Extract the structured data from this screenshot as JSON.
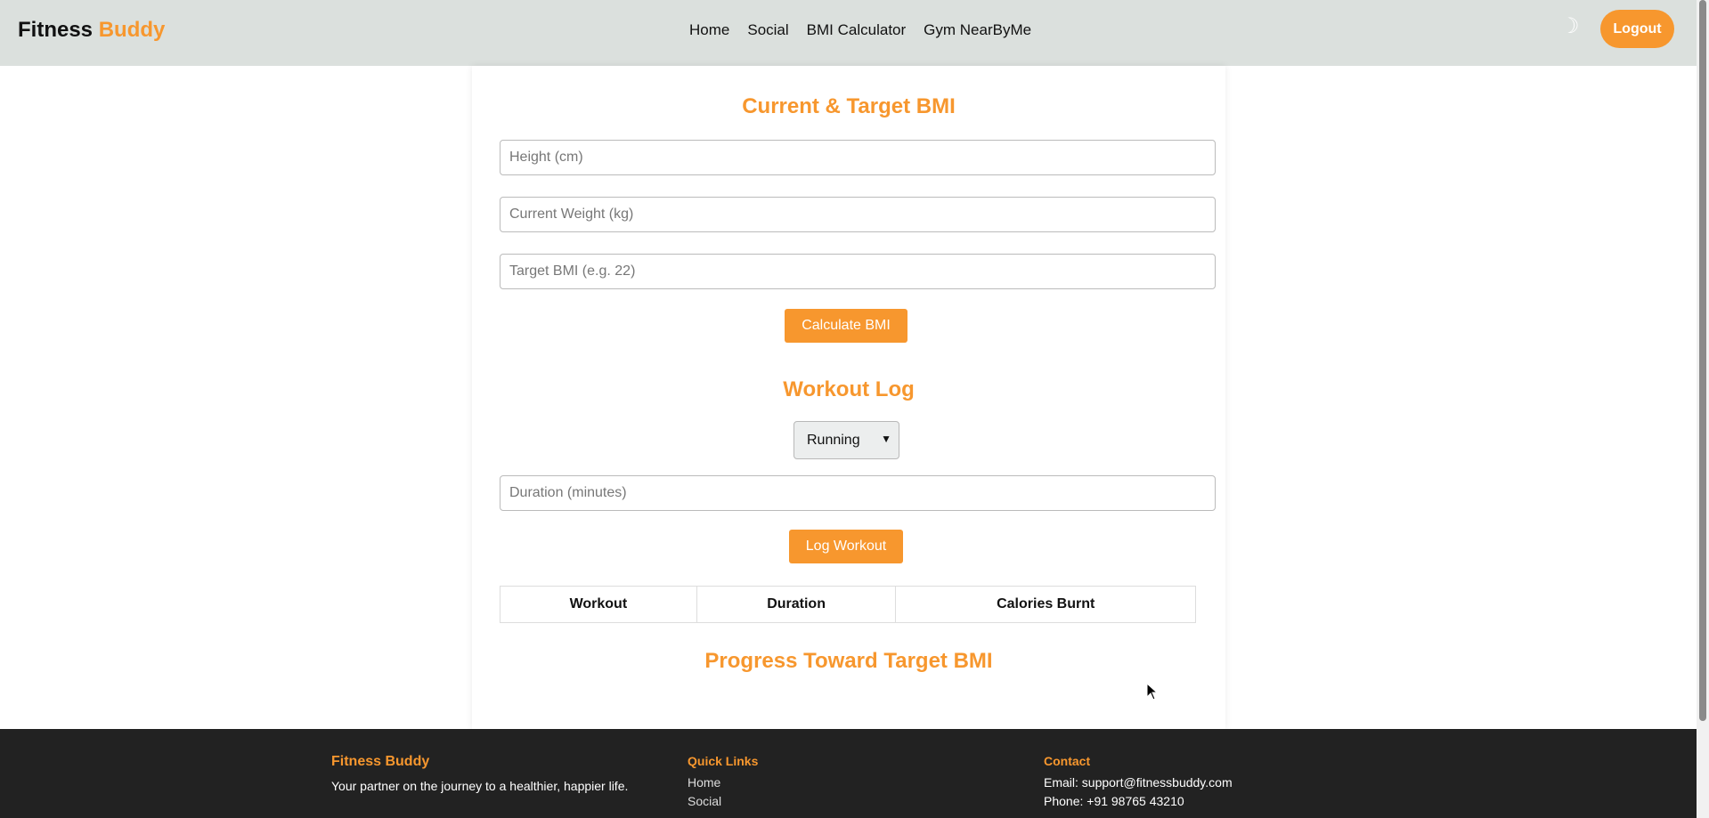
{
  "navbar": {
    "brand_main": "Fitness",
    "brand_accent": "Buddy",
    "links": [
      "Home",
      "Social",
      "BMI Calculator",
      "Gym NearByMe"
    ],
    "theme_icon": "moon-icon",
    "logout_label": "Logout"
  },
  "bmi": {
    "title": "Current & Target BMI",
    "height_placeholder": "Height (cm)",
    "weight_placeholder": "Current Weight (kg)",
    "target_placeholder": "Target BMI (e.g. 22)",
    "calculate_label": "Calculate BMI"
  },
  "workout": {
    "title": "Workout Log",
    "selected_workout": "Running",
    "duration_placeholder": "Duration (minutes)",
    "log_label": "Log Workout",
    "table_headers": [
      "Workout",
      "Duration",
      "Calories Burnt"
    ]
  },
  "progress": {
    "title": "Progress Toward Target BMI"
  },
  "footer": {
    "brand": "Fitness Buddy",
    "tagline": "Your partner on the journey to a healthier, happier life.",
    "quick_links_title": "Quick Links",
    "quick_links": [
      "Home",
      "Social"
    ],
    "contact_title": "Contact",
    "email": "Email: support@fitnessbuddy.com",
    "phone": "Phone: +91 98765 43210"
  },
  "colors": {
    "accent": "#f7972e",
    "navbar_bg": "#dbe0dd",
    "footer_bg": "#222222"
  }
}
